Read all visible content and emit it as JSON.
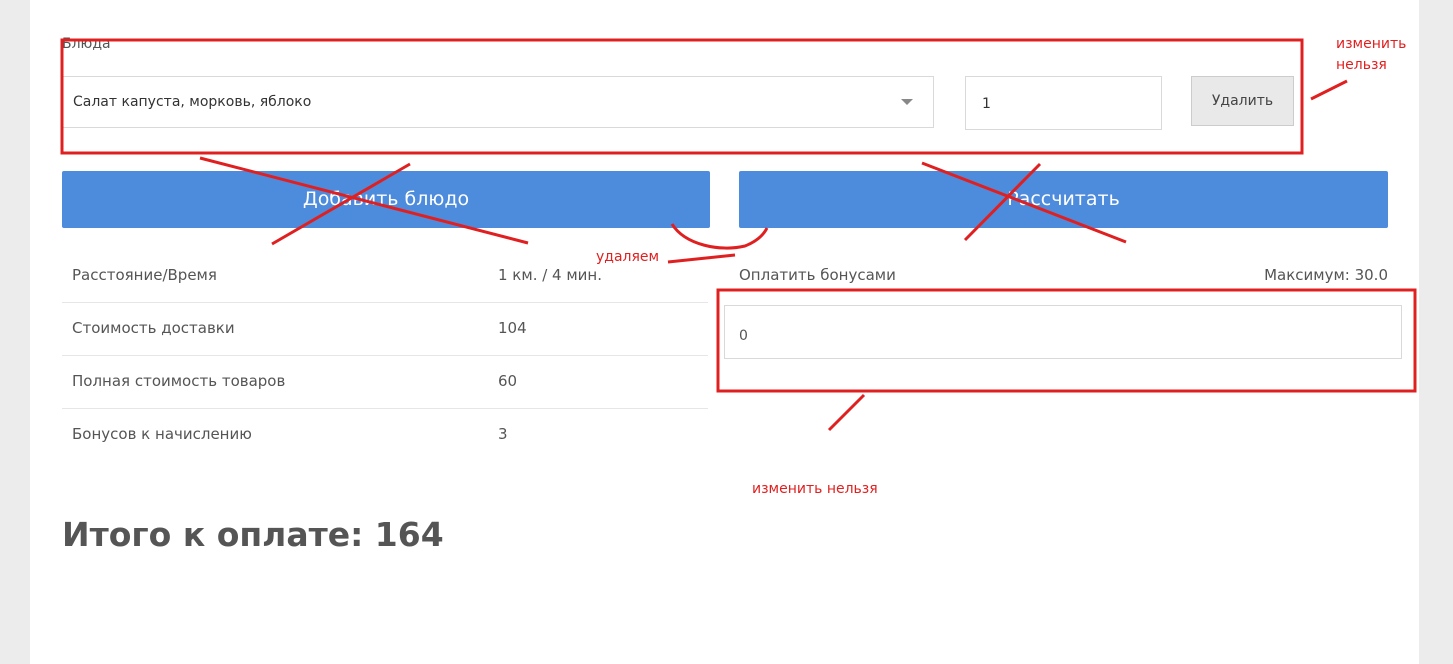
{
  "form": {
    "dishes_label": "Блюда",
    "dish_select_value": "Салат капуста, морковь, яблоко",
    "quantity_value": "1",
    "delete_label": "Удалить",
    "add_dish_label": "Добавить блюдо",
    "calculate_label": "Рассчитать"
  },
  "info": {
    "rows": [
      {
        "label": "Расстояние/Время",
        "value": "1 км. / 4 мин."
      },
      {
        "label": "Стоимость доставки",
        "value": "104"
      },
      {
        "label": "Полная стоимость товаров",
        "value": "60"
      },
      {
        "label": "Бонусов к начислению",
        "value": "3"
      }
    ]
  },
  "bonus": {
    "label": "Оплатить бонусами",
    "max_text": "Максимум: 30.0",
    "input_value": "0"
  },
  "total": {
    "text": "Итого к оплате: 164"
  },
  "annotations": {
    "top_right_line1": "изменить",
    "top_right_line2": "нельзя",
    "middle": "удаляем",
    "bottom": "изменить нельзя",
    "color": "#e02020"
  },
  "colors": {
    "primary_button": "#4d8bdc",
    "page_background": "#ececec"
  }
}
